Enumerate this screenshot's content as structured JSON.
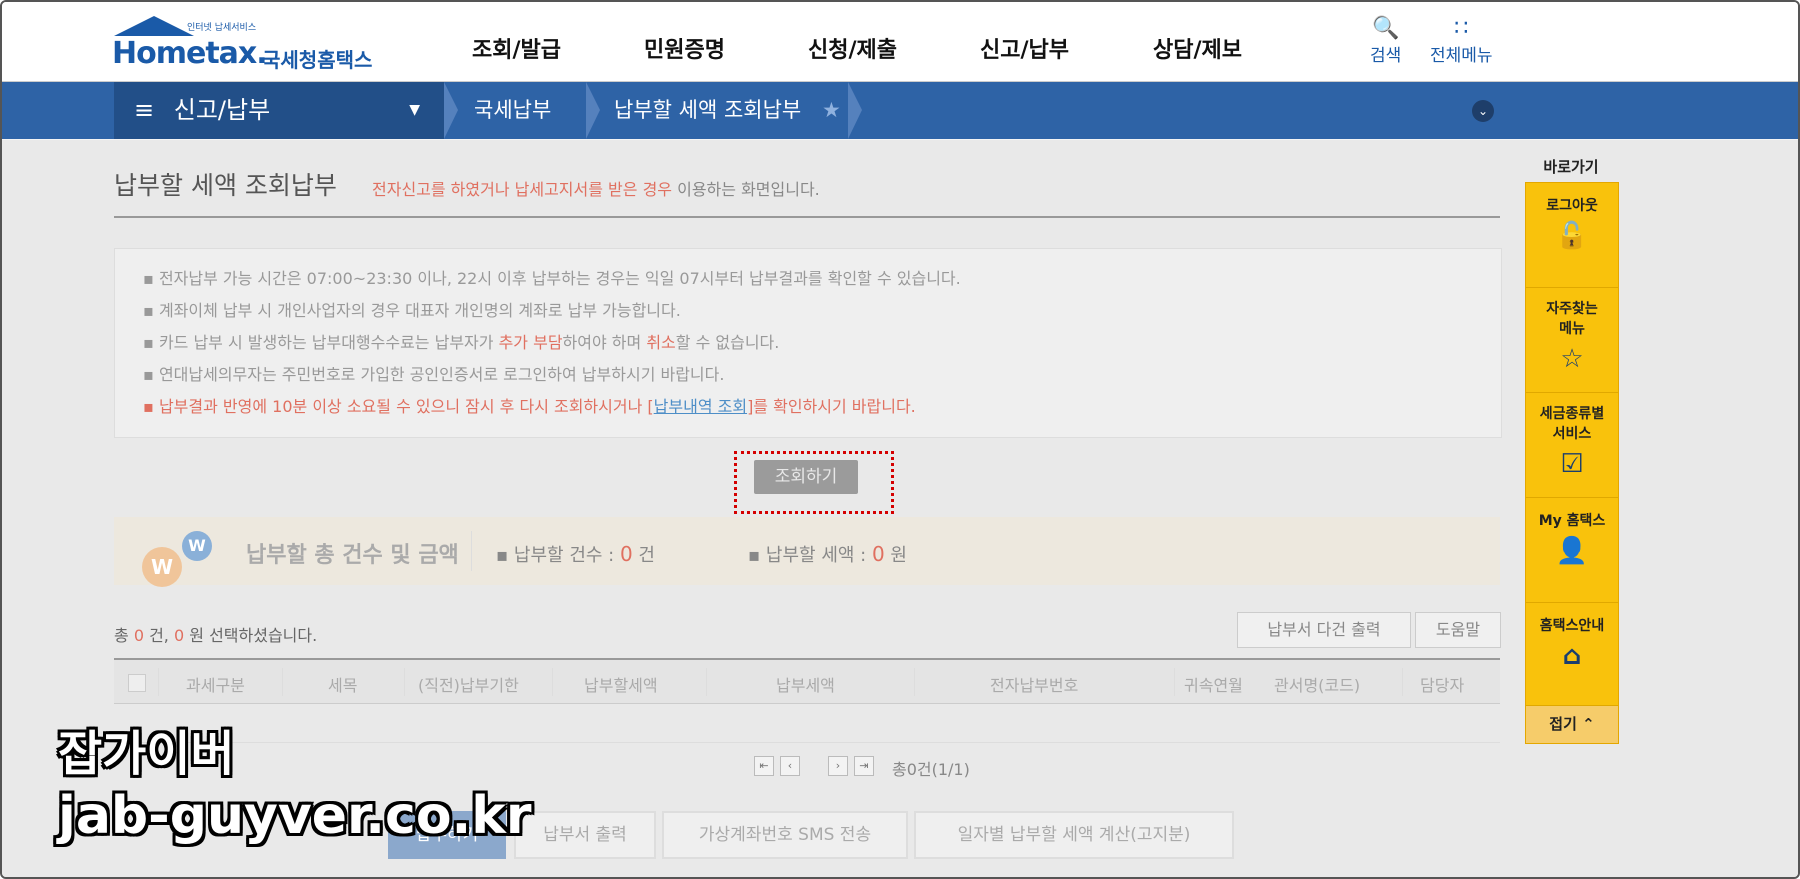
{
  "header": {
    "logo_small": "인터넷 납세서비스",
    "logo_main": "Hometax.",
    "logo_kr": "국세청홈택스",
    "nav": [
      "조회/발급",
      "민원증명",
      "신청/제출",
      "신고/납부",
      "상담/제보"
    ],
    "search_label": "검색",
    "allmenu_label": "전체메뉴"
  },
  "breadcrumb": {
    "menu": "신고/납부",
    "level1": "국세납부",
    "level2": "납부할 세액 조회납부"
  },
  "page": {
    "title": "납부할 세액 조회납부",
    "subtitle_red": "전자신고를 하였거나 납세고지서를 받은 경우",
    "subtitle_rest": " 이용하는 화면입니다."
  },
  "notices": [
    "전자납부 가능 시간은 07:00~23:30 이나, 22시 이후 납부하는 경우는 익일 07시부터 납부결과를 확인할 수 있습니다.",
    "계좌이체 납부 시 개인사업자의 경우 대표자 개인명의 계좌로 납부 가능합니다.",
    "카드 납부 시 발생하는 납부대행수수료는 납부자가 ",
    "연대납세의무자는 주민번호로 가입한 공인인증서로 로그인하여 납부하시기 바랍니다.",
    "납부결과 반영에 10분 이상 소요될 수 있으니 잠시 후 다시 조회하시거나 ["
  ],
  "notice3_parts": {
    "red1": "추가 부담",
    "mid": "하여야 하며 ",
    "red2": "취소",
    "end": "할 수 없습니다."
  },
  "notice5_parts": {
    "link": "납부내역 조회",
    "end": "]를 확인하시기 바랍니다."
  },
  "search_button": "조회하기",
  "summary": {
    "label": "납부할 총 건수 및 금액",
    "count_label": "납부할 건수 : ",
    "count_value": "0",
    "count_unit": " 건",
    "amount_label": "납부할 세액 : ",
    "amount_value": "0",
    "amount_unit": " 원",
    "w_big": "W",
    "w_small": "W"
  },
  "selection": {
    "prefix": "총 ",
    "count": "0",
    "mid": " 건, ",
    "amount": "0",
    "suffix": " 원 선택하셨습니다."
  },
  "table_buttons": {
    "multi_print": "납부서 다건 출력",
    "help": "도움말"
  },
  "table_columns": [
    "과세구분",
    "세목",
    "(직전)납부기한",
    "납부할세액",
    "납부세액",
    "전자납부번호",
    "귀속연월",
    "관서명(코드)",
    "담당자"
  ],
  "pager": {
    "text": "총0건(1/1)"
  },
  "bottom_buttons": [
    "납부하기",
    "납부서 출력",
    "가상계좌번호 SMS 전송",
    "일자별 납부할 세액 계산(고지분)"
  ],
  "quick_menu": {
    "title": "바로가기",
    "items": [
      "로그아웃",
      "자주찾는 메뉴",
      "세금종류별 서비스",
      "My 홈택스",
      "홈택스안내"
    ],
    "fold": "접기"
  },
  "watermark": {
    "line1": "잡가이버",
    "line2": "jab-guyver.co.kr"
  },
  "icons": [
    "search-icon",
    "grid-menu-icon",
    "hamburger-icon",
    "star-icon",
    "lock-icon",
    "checkbox-icon",
    "person-icon",
    "house-icon"
  ]
}
